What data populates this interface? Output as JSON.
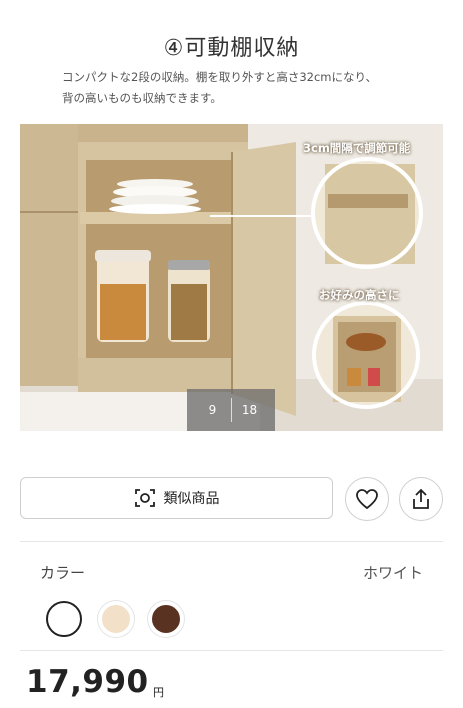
{
  "section": {
    "heading": "④可動棚収納",
    "description_line1": "コンパクトな2段の収納。棚を取り外すと高さ32cmになり、",
    "description_line2": "背の高いものも収納できます。"
  },
  "image": {
    "callout_top": "3cm間隔で調節可能",
    "callout_bottom": "お好みの高さに",
    "counter_current": "9",
    "counter_total": "18"
  },
  "actions": {
    "similar_label": "類似商品",
    "favorite_icon": "heart-icon",
    "share_icon": "share-icon",
    "similar_icon": "camera-search-icon"
  },
  "color": {
    "label": "カラー",
    "selected": "ホワイト",
    "swatches": [
      "#ffffff",
      "#f2e0c8",
      "#5a3221"
    ]
  },
  "price": {
    "value": "17,990",
    "unit": "円"
  }
}
